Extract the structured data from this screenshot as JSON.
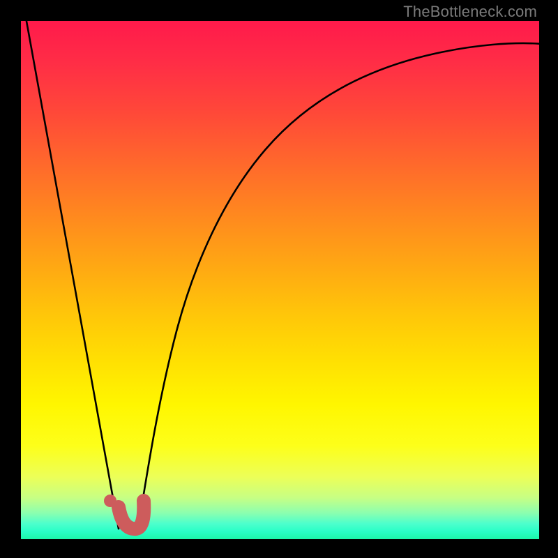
{
  "watermark": "TheBottleneck.com",
  "colors": {
    "frame": "#000000",
    "curve": "#000000",
    "marker_fill": "#cd5c5c",
    "marker_stroke": "#cd5c5c"
  },
  "chart_data": {
    "type": "line",
    "title": "",
    "xlabel": "",
    "ylabel": "",
    "xlim": [
      0,
      1
    ],
    "ylim": [
      0,
      1
    ],
    "grid": false,
    "background": "rainbow-vertical-gradient",
    "series": [
      {
        "name": "left-line",
        "type": "line",
        "points": [
          {
            "x": 0.01,
            "y": 1.0
          },
          {
            "x": 0.19,
            "y": 0.02
          }
        ]
      },
      {
        "name": "right-curve",
        "type": "curve",
        "points": [
          {
            "x": 0.225,
            "y": 0.02
          },
          {
            "x": 0.26,
            "y": 0.18
          },
          {
            "x": 0.3,
            "y": 0.34
          },
          {
            "x": 0.35,
            "y": 0.49
          },
          {
            "x": 0.41,
            "y": 0.62
          },
          {
            "x": 0.48,
            "y": 0.72
          },
          {
            "x": 0.56,
            "y": 0.8
          },
          {
            "x": 0.65,
            "y": 0.86
          },
          {
            "x": 0.75,
            "y": 0.905
          },
          {
            "x": 0.87,
            "y": 0.935
          },
          {
            "x": 1.0,
            "y": 0.953
          }
        ]
      }
    ],
    "annotations": [
      {
        "name": "highlight-dot",
        "type": "dot",
        "x": 0.173,
        "y": 0.075,
        "color": "#cd5c5c",
        "size": 10
      },
      {
        "name": "highlight-hook",
        "type": "path",
        "color": "#cd5c5c",
        "width": 20,
        "points": [
          {
            "x": 0.19,
            "y": 0.065
          },
          {
            "x": 0.198,
            "y": 0.018
          },
          {
            "x": 0.23,
            "y": 0.022
          },
          {
            "x": 0.235,
            "y": 0.08
          }
        ]
      }
    ]
  }
}
